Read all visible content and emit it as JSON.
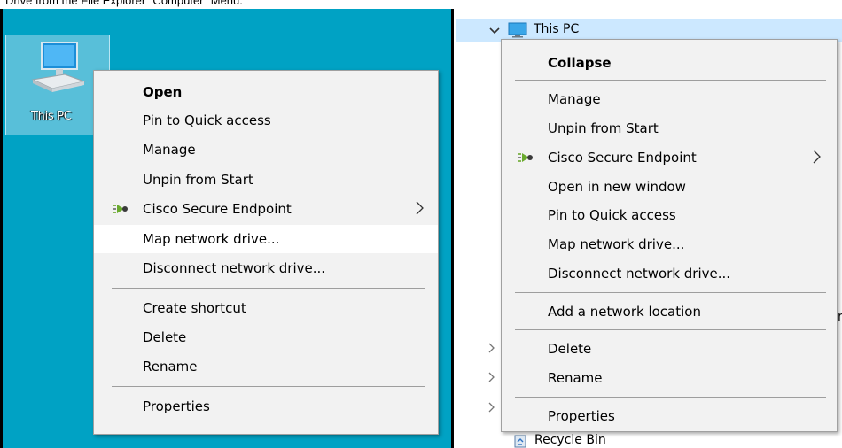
{
  "caption": {
    "text": "Drive from the File Explorer \"Computer\" Menu."
  },
  "desktop": {
    "icon_label": "This PC",
    "menu": [
      {
        "label": "Open",
        "bold": true
      },
      {
        "label": "Pin to Quick access"
      },
      {
        "label": "Manage"
      },
      {
        "label": "Unpin from Start"
      },
      {
        "label": "Cisco Secure Endpoint",
        "submenu": true
      },
      {
        "label": "Map network drive...",
        "hover": true
      },
      {
        "label": "Disconnect network drive..."
      },
      {
        "label": "Create shortcut"
      },
      {
        "label": "Delete"
      },
      {
        "label": "Rename"
      },
      {
        "label": "Properties"
      }
    ]
  },
  "explorer": {
    "tree_item": "This PC",
    "recycle_bin": "Recycle Bin",
    "partial_char": "r",
    "menu": [
      {
        "label": "Collapse",
        "bold": true
      },
      {
        "label": "Manage"
      },
      {
        "label": "Unpin from Start"
      },
      {
        "label": "Cisco Secure Endpoint",
        "submenu": true
      },
      {
        "label": "Open in new window"
      },
      {
        "label": "Pin to Quick access"
      },
      {
        "label": "Map network drive..."
      },
      {
        "label": "Disconnect network drive..."
      },
      {
        "label": "Add a network location"
      },
      {
        "label": "Delete"
      },
      {
        "label": "Rename"
      },
      {
        "label": "Properties"
      }
    ]
  },
  "colors": {
    "desktop_bg": "#00a2c4",
    "menu_bg": "#f2f2f2",
    "selection": "#cce8ff",
    "cisco_green": "#6aaa2e"
  }
}
